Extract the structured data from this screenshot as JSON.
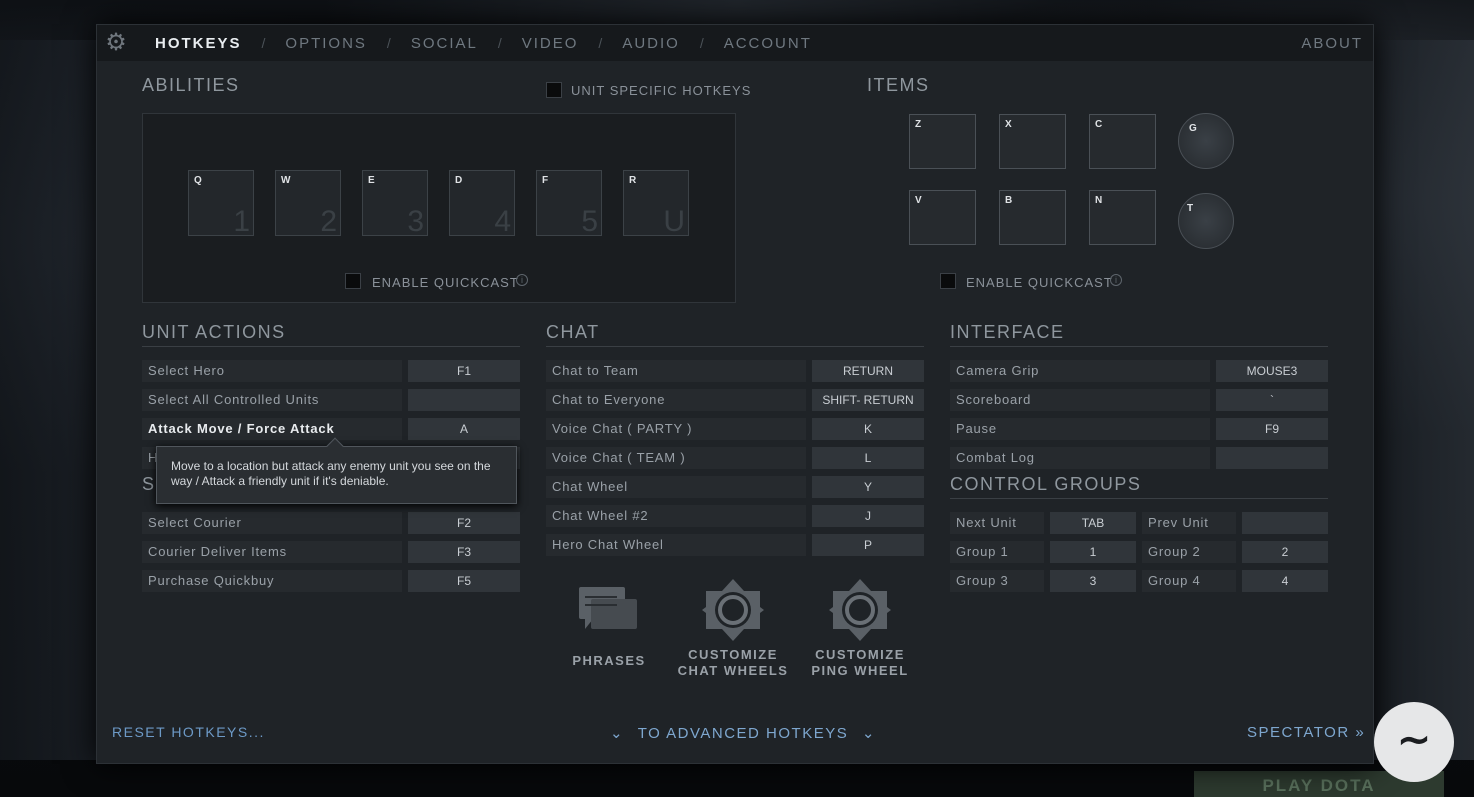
{
  "nav": {
    "items": [
      "HOTKEYS",
      "OPTIONS",
      "SOCIAL",
      "VIDEO",
      "AUDIO",
      "ACCOUNT"
    ],
    "active": "HOTKEYS",
    "about": "ABOUT"
  },
  "abilities": {
    "title": "ABILITIES",
    "unit_specific_label": "UNIT SPECIFIC HOTKEYS",
    "slots": [
      {
        "key": "Q",
        "num": "1"
      },
      {
        "key": "W",
        "num": "2"
      },
      {
        "key": "E",
        "num": "3"
      },
      {
        "key": "D",
        "num": "4"
      },
      {
        "key": "F",
        "num": "5"
      },
      {
        "key": "R",
        "num": "U"
      }
    ],
    "quickcast_label": "ENABLE QUICKCAST"
  },
  "items": {
    "title": "ITEMS",
    "slots": [
      "Z",
      "X",
      "C",
      "V",
      "B",
      "N"
    ],
    "extra": [
      "G",
      "T"
    ],
    "quickcast_label": "ENABLE QUICKCAST"
  },
  "unit_actions": {
    "title": "UNIT ACTIONS",
    "rows": [
      {
        "label": "Select Hero",
        "key": "F1"
      },
      {
        "label": "Select All Controlled Units",
        "key": ""
      },
      {
        "label": "Attack Move / Force Attack",
        "key": "A"
      },
      {
        "label": "H",
        "key": ""
      }
    ],
    "partial_label": "S",
    "rows2": [
      {
        "label": "Select Courier",
        "key": "F2"
      },
      {
        "label": "Courier Deliver Items",
        "key": "F3"
      },
      {
        "label": "Purchase Quickbuy",
        "key": "F5"
      }
    ],
    "tooltip": "Move to a location but attack any enemy unit you see on the way / Attack a friendly unit if it's deniable."
  },
  "chat": {
    "title": "CHAT",
    "rows": [
      {
        "label": "Chat to Team",
        "key": "RETURN"
      },
      {
        "label": "Chat to Everyone",
        "key": "SHIFT- RETURN"
      },
      {
        "label": "Voice Chat ( PARTY )",
        "key": "K"
      },
      {
        "label": "Voice Chat ( TEAM )",
        "key": "L"
      },
      {
        "label": "Chat Wheel",
        "key": "Y"
      },
      {
        "label": "Chat Wheel #2",
        "key": "J"
      },
      {
        "label": "Hero Chat Wheel",
        "key": "P"
      }
    ],
    "buttons": [
      {
        "line1": "PHRASES",
        "line2": ""
      },
      {
        "line1": "CUSTOMIZE",
        "line2": "CHAT WHEELS"
      },
      {
        "line1": "CUSTOMIZE",
        "line2": "PING WHEEL"
      }
    ]
  },
  "interface": {
    "title": "INTERFACE",
    "rows": [
      {
        "label": "Camera Grip",
        "key": "MOUSE3"
      },
      {
        "label": "Scoreboard",
        "key": "`"
      },
      {
        "label": "Pause",
        "key": "F9"
      },
      {
        "label": "Combat Log",
        "key": ""
      }
    ]
  },
  "control_groups": {
    "title": "CONTROL GROUPS",
    "rows": [
      {
        "l1": "Next Unit",
        "k1": "TAB",
        "l2": "Prev Unit",
        "k2": ""
      },
      {
        "l1": "Group 1",
        "k1": "1",
        "l2": "Group 2",
        "k2": "2"
      },
      {
        "l1": "Group 3",
        "k1": "3",
        "l2": "Group 4",
        "k2": "4"
      }
    ]
  },
  "footer": {
    "reset": "RESET HOTKEYS...",
    "advanced": "TO ADVANCED HOTKEYS",
    "spectator": "SPECTATOR"
  },
  "background": {
    "play_button": "PLAY DOTA"
  }
}
